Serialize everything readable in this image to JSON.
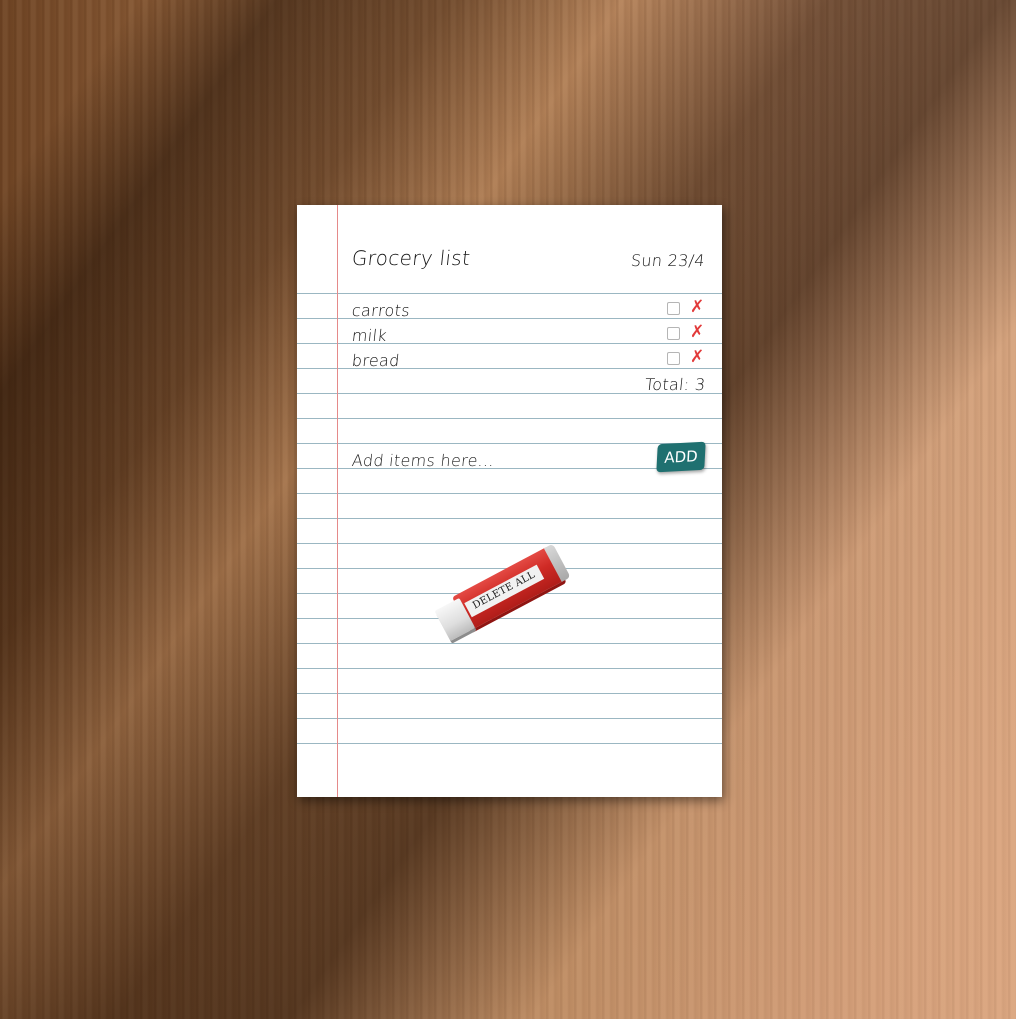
{
  "list": {
    "title": "Grocery list",
    "date": "Sun 23/4",
    "items": [
      {
        "name": "carrots",
        "checked": false,
        "delete_icon": "✗"
      },
      {
        "name": "milk",
        "checked": false,
        "delete_icon": "✗"
      },
      {
        "name": "bread",
        "checked": false,
        "delete_icon": "✗"
      }
    ],
    "total_label": "Total: 3"
  },
  "add": {
    "placeholder": "Add items here...",
    "button_label": "ADD"
  },
  "eraser": {
    "label": "DELETE ALL"
  },
  "colors": {
    "margin_line": "#e58a8a",
    "ruled_line": "#9bb7c2",
    "add_button": "#1f7070",
    "delete_icon": "#e23a3a",
    "eraser": "#cf2a25"
  }
}
